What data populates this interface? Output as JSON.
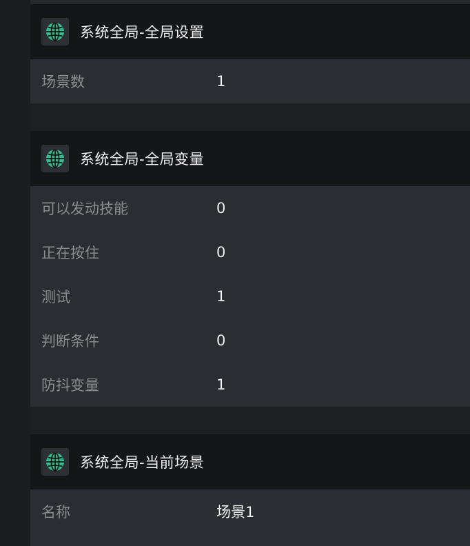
{
  "panels": [
    {
      "title": "系统全局-全局设置",
      "icon": "globe-icon",
      "rows": [
        {
          "label": "场景数",
          "value": "1"
        }
      ]
    },
    {
      "title": "系统全局-全局变量",
      "icon": "globe-icon",
      "rows": [
        {
          "label": "可以发动技能",
          "value": "0"
        },
        {
          "label": "正在按住",
          "value": "0"
        },
        {
          "label": "测试",
          "value": "1"
        },
        {
          "label": "判断条件",
          "value": "0"
        },
        {
          "label": "防抖变量",
          "value": "1"
        }
      ]
    },
    {
      "title": "系统全局-当前场景",
      "icon": "globe-icon",
      "rows": [
        {
          "label": "名称",
          "value": "场景1"
        }
      ]
    }
  ],
  "colors": {
    "background": "#1e2023",
    "header": "#151618",
    "body": "#2a2d31",
    "globe": "#2fbf8f",
    "label": "#8a8c8f",
    "value": "#f2f2f2"
  }
}
